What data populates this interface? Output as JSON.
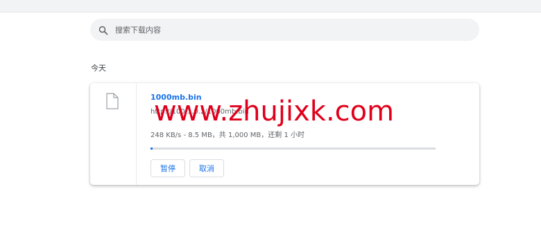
{
  "search": {
    "placeholder": "搜索下载内容",
    "icon": "search-icon"
  },
  "section": {
    "title": "今天"
  },
  "download": {
    "file_name": "1000mb.bin",
    "url": "http://100.1.0.2/1000mb.bin",
    "status": "248 KB/s - 8.5 MB，共 1,000 MB，还剩 1 小时",
    "progress_fraction": 0.0085,
    "pause_label": "暂停",
    "cancel_label": "取消"
  },
  "watermark": {
    "text": "www.zhujixk.com",
    "color": "#e0001b"
  },
  "colors": {
    "accent": "#1a73e8",
    "search_bg": "#f1f3f4",
    "track": "#dadce0"
  }
}
